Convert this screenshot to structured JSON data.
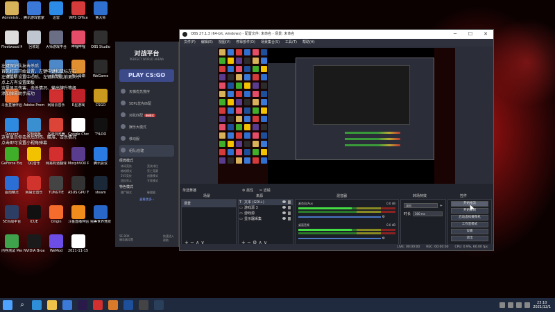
{
  "desktop": {
    "icons": [
      {
        "label": "Administr...",
        "color": "#d8b25a"
      },
      {
        "label": "腾讯游戏管家",
        "color": "#3a79d8"
      },
      {
        "label": "迅雷",
        "color": "#2b8be6"
      },
      {
        "label": "WPS Office",
        "color": "#d63b3b"
      },
      {
        "label": "鲁大师",
        "color": "#2f6fd0"
      },
      {
        "label": "Fleetwood Mac - T...",
        "color": "#dddddd"
      },
      {
        "label": "回收站",
        "color": "#bfc6cf"
      },
      {
        "label": "大师游戏平台",
        "color": "#6a6f86"
      },
      {
        "label": "哔哩哔哩",
        "color": "#e44c67"
      },
      {
        "label": "OBS Studio",
        "color": "#303030"
      },
      {
        "label": "鼠标宏",
        "color": "#4c8fd8"
      },
      {
        "label": "Ps",
        "color": "#1e4f9a"
      },
      {
        "label": "此电脑",
        "color": "#4d88c9"
      },
      {
        "label": "金山毒霸",
        "color": "#e09030"
      },
      {
        "label": "WeGame",
        "color": "#2b2b2b"
      },
      {
        "label": "斗鱼直播伴侣",
        "color": "#e86a2a"
      },
      {
        "label": "Adobe Premie...",
        "color": "#2a1a4a"
      },
      {
        "label": "网易云音乐",
        "color": "#d23030"
      },
      {
        "label": "R星游戏",
        "color": "#c0222a"
      },
      {
        "label": "CSGO",
        "color": "#c99a1e"
      },
      {
        "label": "Tencent",
        "color": "#2e8ae0"
      },
      {
        "label": "控制面板",
        "color": "#3a8fd0"
      },
      {
        "label": "谷歌浏览器",
        "color": "#db4437"
      },
      {
        "label": "Google Chrome",
        "color": "#ffffff"
      },
      {
        "label": "TYLOO",
        "color": "#111111"
      },
      {
        "label": "GeForce Experience",
        "color": "#3fae29"
      },
      {
        "label": "QQ音乐",
        "color": "#f2c100"
      },
      {
        "label": "网易有道翻译",
        "color": "#d32f2f"
      },
      {
        "label": "MorphVOX Pro",
        "color": "#5a3c8e"
      },
      {
        "label": "腾讯会议",
        "color": "#2a7be4"
      },
      {
        "label": "驱动精灵",
        "color": "#2b6fd6"
      },
      {
        "label": "网易云音乐",
        "color": "#d0342c"
      },
      {
        "label": "TUNGTIE",
        "color": "#444444"
      },
      {
        "label": "ASUS GPU Tweak II",
        "color": "#333333"
      },
      {
        "label": "steam",
        "color": "#1b2838"
      },
      {
        "label": "5E对战平台",
        "color": "#2d3e64"
      },
      {
        "label": "iCUE",
        "color": "#111111"
      },
      {
        "label": "Origin",
        "color": "#f56c2d"
      },
      {
        "label": "斗鱼直播伴侣",
        "color": "#f08c1c"
      },
      {
        "label": "完美世界竞技",
        "color": "#2866c7"
      },
      {
        "label": "内存测试 MemTest",
        "color": "#3ea34a"
      },
      {
        "label": "NVIDIA Broadcast",
        "color": "#1a1a1a"
      },
      {
        "label": "WeMod",
        "color": "#6c4de6"
      },
      {
        "label": "2021-11-15 23-09-57",
        "color": "#ffffff"
      }
    ],
    "overlay_lines": [
      "左键保护队友击杀后",
      "首先打开开始设置，左键中键和鼠标左右",
      "左键监听设置中心后，左键启动此前更大小",
      "点上方有设置面板",
      "这里显示伤害、击杀情况、输出牌升等级",
      "添加弹幕助手成功",
      "这里显示你击杀后的伤、瞄准、击杀情况",
      "点击即可设置小视角弹幕"
    ]
  },
  "launcher": {
    "logo": "对战平台",
    "logo_sub": "PERFECT WORLD ARENA",
    "play_label": "PLAY CS:GO",
    "menu": [
      {
        "label": "天梯优先排序",
        "active": false
      },
      {
        "label": "5EPL优先匹配",
        "active": false
      },
      {
        "label": "对抗匹配",
        "hot": "新模式",
        "active": false
      },
      {
        "label": "娱乐大模式",
        "active": false
      },
      {
        "label": "移动服",
        "active": false
      },
      {
        "label": "组队/创建",
        "active": true
      }
    ],
    "section_mode": "经典模式",
    "mode_items": [
      "休闲竞技",
      "竞技排位",
      "练枪模式",
      "死亡竞赛",
      "5V5竞技",
      "创意模式",
      "团队死斗",
      "专家模式"
    ],
    "section_extra": "特色模式",
    "extra_items": [
      "僵尸模式",
      "躲猫猫"
    ],
    "more_link": "查看更多 ›",
    "footer_left": "5E BOX",
    "footer_right": "快速进入",
    "footer_left2": "服务器设置",
    "footer_right2": "帮助"
  },
  "obs": {
    "title": "OBS 27.1.3 (64-bit, windows) - 配置文件: 未命名 - 场景: 未命名",
    "menu": [
      "文件(F)",
      "编辑(E)",
      "视图(V)",
      "停靠部件(D)",
      "场景集合(S)",
      "工具(T)",
      "帮助(H)"
    ],
    "docks": {
      "scenes_header": "场景",
      "sources_header": "来源",
      "mixer_header": "混音器",
      "transitions_header": "转场特效",
      "controls_header": "控件",
      "toolbar_label": "单选舞播",
      "toolbar_mid1": "⚙ 属性",
      "toolbar_mid2": "✂ 滤镜",
      "scenes": [
        "场景"
      ],
      "sources": [
        {
          "label": "文本 (GDI+)",
          "type": "T"
        },
        {
          "label": "游戏源 3",
          "type": "▭"
        },
        {
          "label": "游戏源",
          "type": "▭"
        },
        {
          "label": "显示器采集",
          "type": "▭"
        }
      ],
      "mixer": [
        {
          "name": "麦克风/Aux",
          "db": "0.0 dB"
        },
        {
          "name": "桌面音频",
          "db": "0.0 dB"
        }
      ],
      "transition_type": "淡出",
      "duration_label": "时长",
      "duration_value": "300 ms",
      "controls": [
        "开始推流",
        "开始录制",
        "启动虚拟摄像机",
        "工作室模式",
        "设置",
        "退出"
      ]
    },
    "status": {
      "live_label": "LIVE:",
      "live_time": "00:00:00",
      "rec_label": "REC:",
      "rec_time": "00:00:00",
      "cpu": "CPU: 0.9%, 60.00 fps"
    }
  },
  "taskbar": {
    "time": "23:10",
    "date": "2021/12/1",
    "apps": [
      {
        "name": "start-icon",
        "color": "#4da3ff"
      },
      {
        "name": "edge-icon",
        "color": "#2f8ed8"
      },
      {
        "name": "file-explorer-icon",
        "color": "#f0c24a"
      },
      {
        "name": "store-icon",
        "color": "#3b7ad6"
      },
      {
        "name": "premiere-icon",
        "color": "#2a1a4a"
      },
      {
        "name": "netease-music-icon",
        "color": "#d22f2f"
      },
      {
        "name": "wegame-icon",
        "color": "#d97a2a"
      },
      {
        "name": "ps-icon",
        "color": "#1e4f9a"
      },
      {
        "name": "obs-icon",
        "color": "#444444"
      },
      {
        "name": "steam-icon",
        "color": "#2a3f5a"
      }
    ]
  }
}
